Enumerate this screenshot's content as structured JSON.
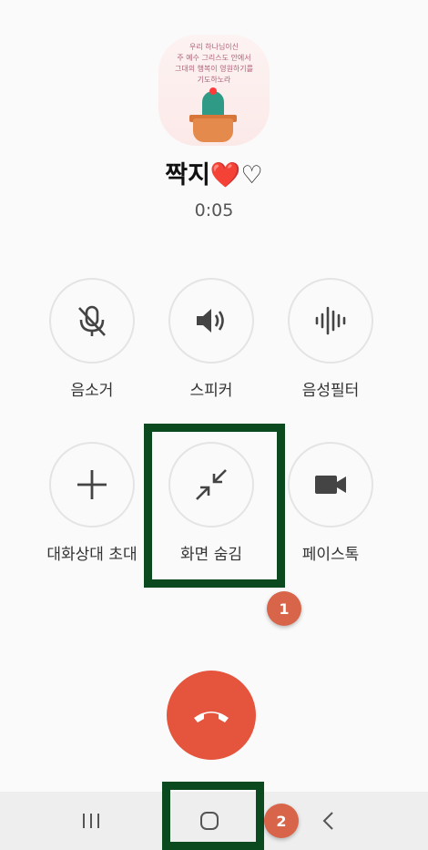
{
  "contact": {
    "name": "짝지❤️♡",
    "call_timer": "0:05",
    "avatar_text": "우리 하나님이신\n주 예수 그리스도 안에서\n그대의 행복이 영원하기를\n기도하노라"
  },
  "controls": [
    {
      "id": "mute",
      "label": "음소거",
      "icon": "mic-off-icon"
    },
    {
      "id": "speaker",
      "label": "스피커",
      "icon": "speaker-icon"
    },
    {
      "id": "voice-filter",
      "label": "음성필터",
      "icon": "voice-wave-icon"
    },
    {
      "id": "add-participant",
      "label": "대화상대 초대",
      "icon": "plus-icon"
    },
    {
      "id": "hide-screen",
      "label": "화면 숨김",
      "icon": "minimize-arrows-icon"
    },
    {
      "id": "facetalk",
      "label": "페이스톡",
      "icon": "video-camera-icon"
    }
  ],
  "end_call": {
    "icon": "phone-hangup-icon",
    "color": "#e5553e"
  },
  "annotations": [
    {
      "number": "1",
      "target": "hide-screen"
    },
    {
      "number": "2",
      "target": "home"
    }
  ],
  "navbar": {
    "recents_icon": "recents-icon",
    "home_icon": "home-icon",
    "back_icon": "back-icon"
  },
  "colors": {
    "highlight": "#0b4a1e",
    "badge": "#d8644a"
  }
}
